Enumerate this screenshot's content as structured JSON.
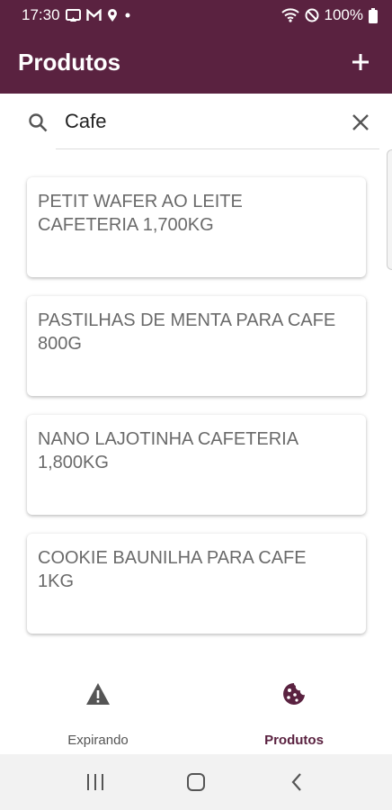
{
  "status_bar": {
    "time": "17:30",
    "battery": "100%",
    "icons": [
      "cast-icon",
      "gmail-icon",
      "location-icon",
      "dot-icon",
      "wifi-icon",
      "do-not-disturb-icon",
      "battery-icon"
    ]
  },
  "app_bar": {
    "title": "Produtos",
    "add_icon": "plus-icon"
  },
  "search": {
    "value": "Cafe",
    "placeholder": "",
    "search_icon": "search-icon",
    "clear_icon": "close-icon"
  },
  "products": [
    {
      "name": "PETIT WAFER AO LEITE\nCAFETERIA 1,700KG"
    },
    {
      "name": "PASTILHAS DE MENTA PARA CAFE\n800G"
    },
    {
      "name": "NANO LAJOTINHA CAFETERIA\n1,800KG"
    },
    {
      "name": "COOKIE BAUNILHA PARA CAFE\n1KG"
    }
  ],
  "bottom_nav": {
    "items": [
      {
        "label": "Expirando",
        "icon": "warning-icon",
        "active": false
      },
      {
        "label": "Produtos",
        "icon": "cookie-icon",
        "active": true
      }
    ]
  },
  "system_nav": {
    "icons": [
      "recents-icon",
      "home-icon",
      "back-icon"
    ]
  },
  "colors": {
    "primary": "#5a2240",
    "card_text": "#6a6a6a",
    "nav_inactive": "#555555"
  }
}
